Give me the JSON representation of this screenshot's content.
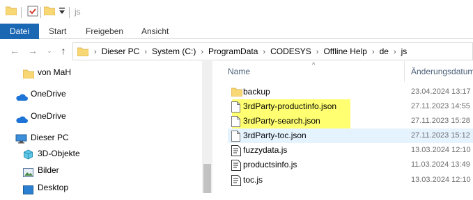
{
  "window": {
    "title": "js"
  },
  "ribbon": {
    "tabs": [
      "Datei",
      "Start",
      "Freigeben",
      "Ansicht"
    ]
  },
  "address": {
    "crumbs": [
      "Dieser PC",
      "System (C:)",
      "ProgramData",
      "CODESYS",
      "Offline Help",
      "de",
      "js"
    ]
  },
  "nav": {
    "items": [
      {
        "label": "von MaH",
        "icon": "folder-icon"
      },
      {
        "label": "OneDrive",
        "icon": "cloud-icon"
      },
      {
        "label": "OneDrive",
        "icon": "cloud-icon"
      },
      {
        "label": "Dieser PC",
        "icon": "computer-icon"
      },
      {
        "label": "3D-Objekte",
        "icon": "cube-icon"
      },
      {
        "label": "Bilder",
        "icon": "pictures-icon"
      },
      {
        "label": "Desktop",
        "icon": "desktop-icon"
      }
    ]
  },
  "columns": {
    "name": "Name",
    "date": "Änderungsdatum"
  },
  "files": [
    {
      "name": "backup",
      "date": "23.04.2024 13:17",
      "type": "folder"
    },
    {
      "name": "3rdParty-productinfo.json",
      "date": "27.11.2023 14:55",
      "type": "json"
    },
    {
      "name": "3rdParty-search.json",
      "date": "27.11.2023 15:28",
      "type": "json"
    },
    {
      "name": "3rdParty-toc.json",
      "date": "27.11.2023 15:12",
      "type": "json"
    },
    {
      "name": "fuzzydata.js",
      "date": "13.03.2024 12:10",
      "type": "js"
    },
    {
      "name": "productsinfo.js",
      "date": "11.03.2024 13:49",
      "type": "js"
    },
    {
      "name": "toc.js",
      "date": "13.03.2024 12:10",
      "type": "js"
    }
  ],
  "colors": {
    "accent": "#1a67b4",
    "highlight": "#ffff58",
    "folder": "#f8d775"
  }
}
